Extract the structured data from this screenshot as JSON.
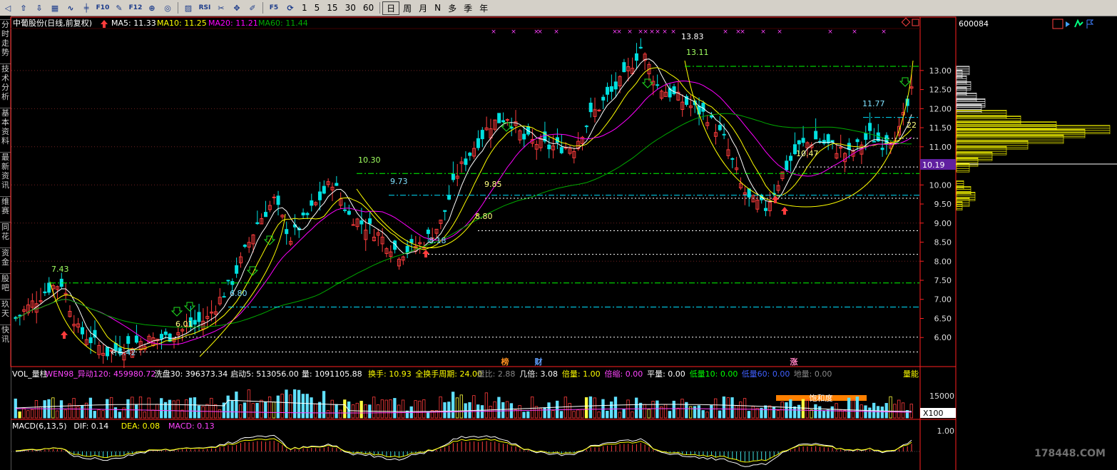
{
  "toolbar": {
    "buttons": [
      {
        "name": "back-icon",
        "glyph": "◁"
      },
      {
        "name": "up-icon",
        "glyph": "⇧"
      },
      {
        "name": "down-icon",
        "glyph": "⇩"
      },
      {
        "name": "grid-icon",
        "glyph": "▦"
      },
      {
        "name": "line-chart-icon",
        "glyph": "∿"
      },
      {
        "name": "kline-icon",
        "glyph": "╪"
      },
      {
        "name": "f10-icon",
        "glyph": "F10"
      },
      {
        "name": "drawing-icon",
        "glyph": "✎"
      },
      {
        "name": "f12-icon",
        "glyph": "F12"
      },
      {
        "name": "zoom-icon",
        "glyph": "⊕"
      },
      {
        "name": "cycle-icon",
        "glyph": "◎"
      }
    ],
    "buttons2": [
      {
        "name": "indicator-icon",
        "glyph": "▨"
      },
      {
        "name": "rsi-icon",
        "glyph": "RSI"
      },
      {
        "name": "tool-icon",
        "glyph": "✂"
      },
      {
        "name": "move-icon",
        "glyph": "✥"
      },
      {
        "name": "pen-icon",
        "glyph": "✐"
      }
    ],
    "buttons3": [
      {
        "name": "f5-icon",
        "glyph": "F5"
      },
      {
        "name": "refresh-icon",
        "glyph": "⟳"
      }
    ],
    "periods": [
      "1",
      "5",
      "15",
      "30",
      "60"
    ],
    "periods2": [
      "日",
      "周",
      "月",
      "N",
      "多",
      "季",
      "年"
    ]
  },
  "sidebar": [
    "分时走势",
    "技术分析",
    "基本资料",
    "最新资讯",
    "维赛",
    "同花",
    "资金",
    "股吧",
    "玖天",
    "快讯"
  ],
  "header": {
    "name": "中葡股份(日线,前复权)",
    "ma5": "MA5: 11.33",
    "ma10": "MA10: 11.25",
    "ma20": "MA20: 11.21",
    "ma60": "MA60: 11.44",
    "code": "600084",
    "current_price": "10.19"
  },
  "colors": {
    "up": "#ff3c3c",
    "down": "#00e0e0",
    "ma5": "#ffffff",
    "ma10": "#ffff00",
    "ma20": "#ff00ff",
    "ma60": "#00aa00",
    "green_dash": "#00ff00",
    "cyan_dash": "#00e0ff",
    "white_dash": "#ffffff",
    "axis": "#ff2020"
  },
  "chart_data": [
    {
      "type": "candlestick",
      "title": "中葡股份(日线,前复权)",
      "y_axis_ticks": [
        "13.00",
        "12.50",
        "12.00",
        "11.50",
        "11.00",
        "10.50",
        "10.00",
        "9.50",
        "9.00",
        "8.50",
        "8.00",
        "7.50",
        "7.00",
        "6.50",
        "6.00"
      ],
      "ylim": [
        5.35,
        14.1
      ],
      "annotations": [
        {
          "label": "13.83",
          "price": 13.83,
          "idx": 141
        },
        {
          "label": "13.11",
          "price": 13.11,
          "idx": 146
        },
        {
          "label": "10.30",
          "price": 10.3,
          "idx": 74
        },
        {
          "label": "9.73",
          "price": 9.73,
          "idx": 82
        },
        {
          "label": "9.85",
          "price": 9.65,
          "idx": 102
        },
        {
          "label": "8.80",
          "price": 8.8,
          "idx": 100
        },
        {
          "label": "8.18",
          "price": 8.18,
          "idx": 89
        },
        {
          "label": "7.43",
          "price": 7.43,
          "idx": 10
        },
        {
          "label": "6.80",
          "price": 6.8,
          "idx": 48
        },
        {
          "label": "6.01",
          "price": 6.01,
          "idx": 36
        },
        {
          "label": "5.42",
          "price": 5.42,
          "idx": 22
        },
        {
          "label": "11.77",
          "price": 11.77,
          "idx": 183
        },
        {
          "label": "10.47",
          "price": 10.47,
          "idx": 168
        },
        {
          "label": "22",
          "price": 11.5,
          "idx": 191
        }
      ],
      "price_levels": [
        {
          "price": 13.11,
          "style": "green"
        },
        {
          "price": 11.77,
          "style": "cyan"
        },
        {
          "price": 11.22,
          "style": "white"
        },
        {
          "price": 10.47,
          "style": "white"
        },
        {
          "price": 10.3,
          "style": "green"
        },
        {
          "price": 9.73,
          "style": "cyan"
        },
        {
          "price": 9.65,
          "style": "white"
        },
        {
          "price": 8.8,
          "style": "white"
        },
        {
          "price": 8.18,
          "style": "white"
        },
        {
          "price": 7.43,
          "style": "green"
        },
        {
          "price": 6.8,
          "style": "cyan"
        },
        {
          "price": 6.01,
          "style": "white"
        },
        {
          "price": 5.62,
          "style": "white"
        }
      ],
      "markers": [
        "榜",
        "财",
        "涨"
      ],
      "volume_profile_price": "10.19"
    },
    {
      "type": "bar",
      "title": "VOL_量柱",
      "labels": [
        {
          "text": "VOL_量柱",
          "color": "#ffffff"
        },
        {
          "text": "WEN98_异动120: 459980.72",
          "color": "#ff44ff"
        },
        {
          "text": "洗盘30: 396373.34",
          "color": "#ffffff"
        },
        {
          "text": "启动5: 513056.00",
          "color": "#ffffff"
        },
        {
          "text": "量: 1091105.88",
          "color": "#ffffff"
        },
        {
          "text": "换手: 10.93",
          "color": "#ffff00"
        },
        {
          "text": "全换手周期: 24.00",
          "color": "#ffff00"
        },
        {
          "text": "量比: 2.88",
          "color": "#888888"
        },
        {
          "text": "几倍: 3.08",
          "color": "#ffffff"
        },
        {
          "text": "倍量: 1.00",
          "color": "#ffff00"
        },
        {
          "text": "倍缩: 0.00",
          "color": "#ff44ff"
        },
        {
          "text": "平量: 0.00",
          "color": "#ffffff"
        },
        {
          "text": "低量10: 0.00",
          "color": "#00ff00"
        },
        {
          "text": "低量60: 0.00",
          "color": "#4060ff"
        },
        {
          "text": "地量: 0.00",
          "color": "#888888"
        }
      ],
      "right_label": "量能",
      "y_tick": "15000",
      "scale": "X100",
      "badge": "饱和度"
    },
    {
      "type": "line",
      "title": "MACD(6,13,5)",
      "labels": [
        {
          "text": "MACD(6,13,5)",
          "color": "#ffffff"
        },
        {
          "text": "DIF: 0.14",
          "color": "#ffffff"
        },
        {
          "text": "DEA: 0.08",
          "color": "#ffff00"
        },
        {
          "text": "MACD: 0.13",
          "color": "#ff44ff"
        }
      ],
      "y_tick": "1.00"
    }
  ],
  "watermark": "178448.COM"
}
